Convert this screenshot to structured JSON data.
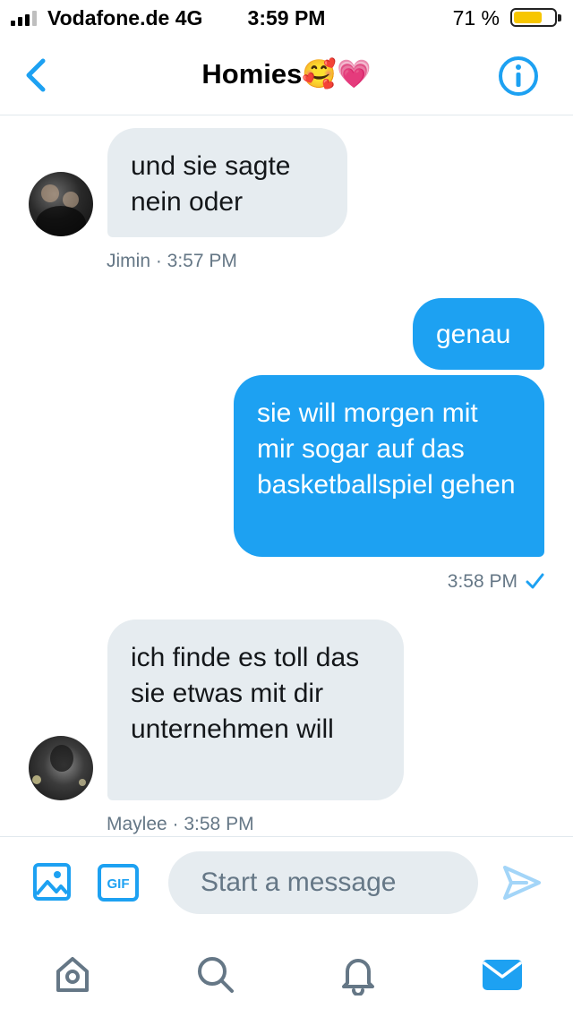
{
  "status_bar": {
    "carrier": "Vodafone.de  4G",
    "time": "3:59 PM",
    "battery_percent": "71 %",
    "battery_level": 0.71,
    "signal_bars_active": 3,
    "signal_bars_total": 4
  },
  "header": {
    "title": "Homies🥰💗",
    "back_icon": "chevron-left-icon",
    "info_icon": "info-circle-icon"
  },
  "messages": [
    {
      "direction": "incoming",
      "text": "und sie sagte nein oder",
      "meta": "Jimin · 3:57 PM"
    },
    {
      "direction": "outgoing",
      "text": "genau"
    },
    {
      "direction": "outgoing",
      "text": "sie will morgen mit mir sogar auf das basketballspiel gehen",
      "meta": "3:58 PM"
    },
    {
      "direction": "incoming",
      "text": "ich finde es toll das sie etwas mit dir unternehmen will",
      "meta": "Maylee · 3:58 PM"
    }
  ],
  "composer": {
    "placeholder": "Start a message",
    "image_icon": "image-icon",
    "gif_label": "GIF",
    "send_icon": "send-icon"
  },
  "tabs": [
    "home-icon",
    "search-icon",
    "notifications-icon",
    "messages-icon"
  ],
  "colors": {
    "accent": "#1da1f2",
    "incoming_bubble": "#e6ecf0",
    "meta_text": "#657786",
    "battery": "#f7c600",
    "tab_icon": "#657786"
  }
}
